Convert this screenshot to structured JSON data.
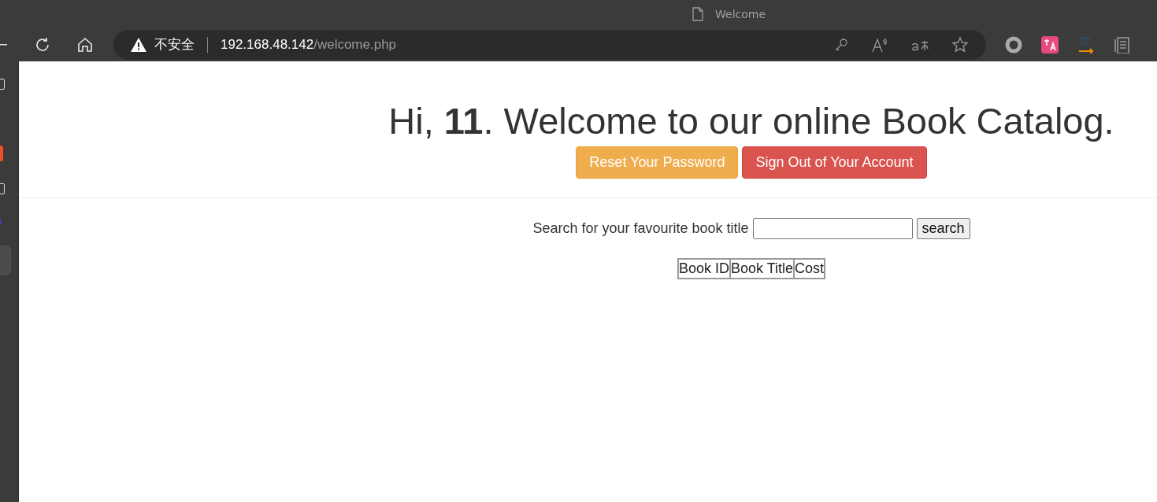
{
  "browser": {
    "tab_title": "Welcome",
    "security_label": "不安全",
    "url_host": "192.168.48.142",
    "url_path": "/welcome.php"
  },
  "page": {
    "heading": "Hi, **11**. Welcome to our online Book Catalog.",
    "buttons": [
      {
        "label": "Reset Your Password",
        "kind": "warning"
      },
      {
        "label": "Sign Out of Your Account",
        "kind": "danger"
      }
    ],
    "search": {
      "label": "Search for your favourite book title",
      "button": "search"
    },
    "table": {
      "columns": [
        "Book ID",
        "Book Title",
        "Cost"
      ]
    }
  }
}
